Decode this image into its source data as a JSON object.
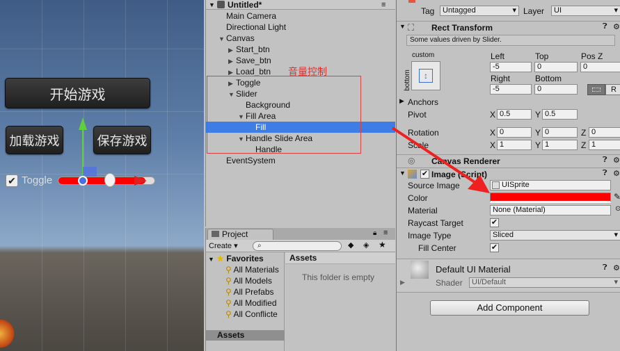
{
  "scene": {
    "start_btn": "开始游戏",
    "load_btn": "加载游戏",
    "save_btn": "保存游戏",
    "toggle_label": "Toggle"
  },
  "hierarchy": {
    "scene_title": "Untitled*",
    "annotation": "音量控制",
    "items": [
      {
        "label": "Main Camera",
        "indent": 0,
        "arrow": ""
      },
      {
        "label": "Directional Light",
        "indent": 0,
        "arrow": ""
      },
      {
        "label": "Canvas",
        "indent": 0,
        "arrow": "▼"
      },
      {
        "label": "Start_btn",
        "indent": 1,
        "arrow": "▶"
      },
      {
        "label": "Save_btn",
        "indent": 1,
        "arrow": "▶"
      },
      {
        "label": "Load_btn",
        "indent": 1,
        "arrow": "▶"
      },
      {
        "label": "Toggle",
        "indent": 1,
        "arrow": "▶"
      },
      {
        "label": "Slider",
        "indent": 1,
        "arrow": "▼"
      },
      {
        "label": "Background",
        "indent": 2,
        "arrow": ""
      },
      {
        "label": "Fill Area",
        "indent": 2,
        "arrow": "▼"
      },
      {
        "label": "Fill",
        "indent": 3,
        "arrow": ""
      },
      {
        "label": "Handle Slide Area",
        "indent": 2,
        "arrow": "▼"
      },
      {
        "label": "Handle",
        "indent": 3,
        "arrow": ""
      },
      {
        "label": "EventSystem",
        "indent": 0,
        "arrow": ""
      }
    ]
  },
  "project": {
    "tab": "Project",
    "create": "Create",
    "favorites": "Favorites",
    "fav_items": [
      "All Materials",
      "All Models",
      "All Prefabs",
      "All Modified",
      "All Conflicte"
    ],
    "assets_header": "Assets",
    "empty_msg": "This folder is empty",
    "assets_root": "Assets"
  },
  "inspector": {
    "tag_label": "Tag",
    "tag_value": "Untagged",
    "layer_label": "Layer",
    "layer_value": "UI",
    "rect_transform": {
      "title": "Rect Transform",
      "note": "Some values driven by Slider.",
      "anchor_preset": "custom",
      "anchor_side": "bottom",
      "left_label": "Left",
      "top_label": "Top",
      "posz_label": "Pos Z",
      "left": "-5",
      "top": "0",
      "posz": "0",
      "right_label": "Right",
      "bottom_label": "Bottom",
      "right": "-5",
      "bottom": "0",
      "r_btn": "R",
      "anchors_label": "Anchors",
      "pivot_label": "Pivot",
      "pivot_x": "0.5",
      "pivot_y": "0.5",
      "rotation_label": "Rotation",
      "rot_x": "0",
      "rot_y": "0",
      "rot_z": "0",
      "scale_label": "Scale",
      "scale_x": "1",
      "scale_y": "1",
      "scale_z": "1",
      "x": "X",
      "y": "Y",
      "z": "Z"
    },
    "canvas_renderer": "Canvas Renderer",
    "image": {
      "title": "Image (Script)",
      "source_label": "Source Image",
      "source_value": "UISprite",
      "color_label": "Color",
      "color": "#ff0000",
      "material_label": "Material",
      "material_value": "None (Material)",
      "raycast_label": "Raycast Target",
      "image_type_label": "Image Type",
      "image_type_value": "Sliced",
      "fill_center_label": "Fill Center"
    },
    "default_material": "Default UI Material",
    "shader_label": "Shader",
    "shader_value": "UI/Default",
    "add_component": "Add Component"
  }
}
